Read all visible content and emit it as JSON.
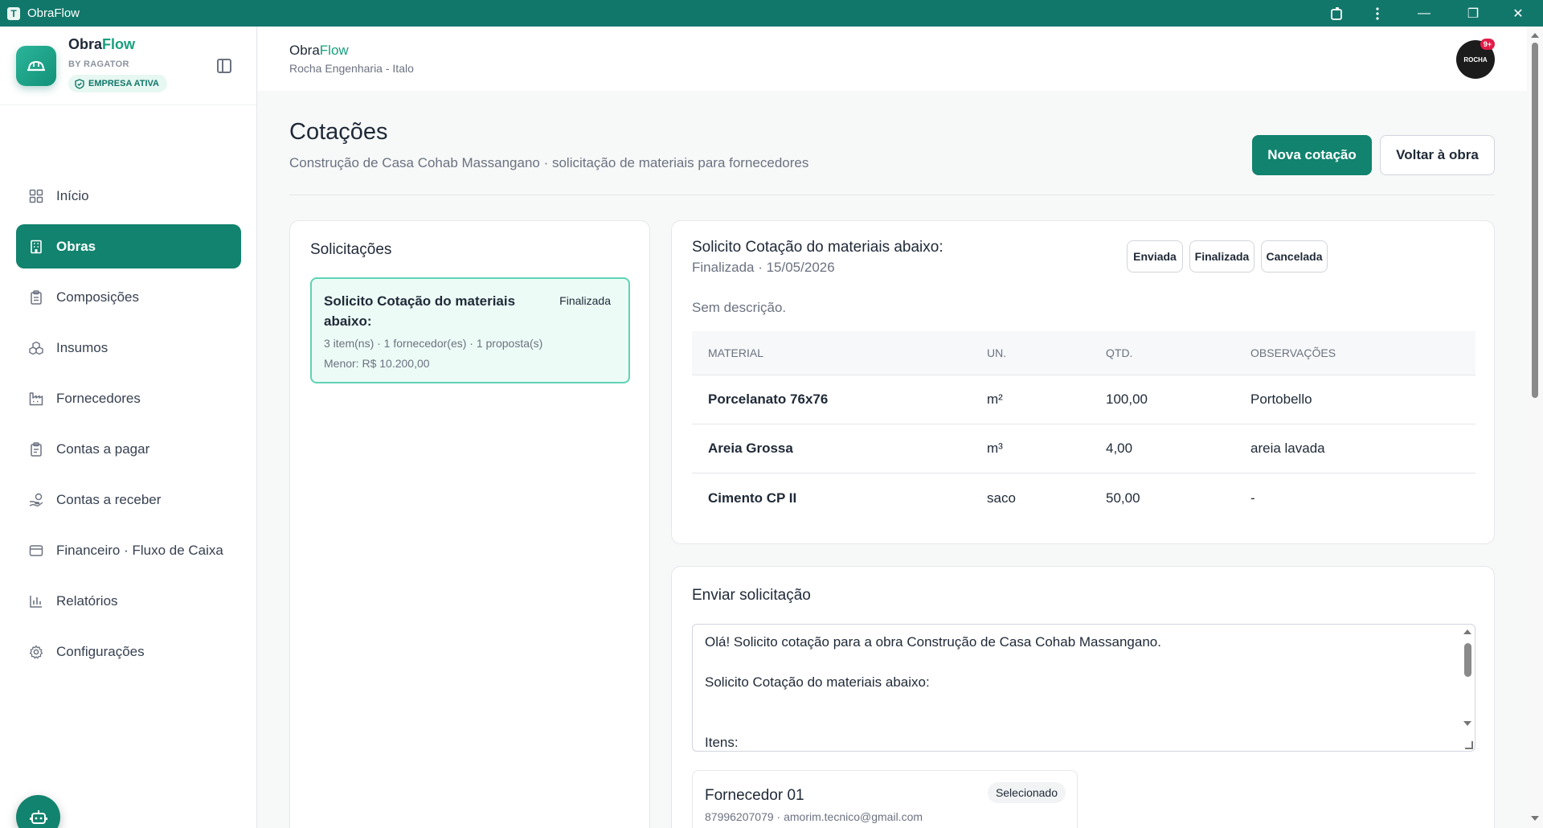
{
  "window": {
    "title": "ObraFlow",
    "controls": {
      "minimize": "—",
      "maximize": "❐",
      "close": "✕"
    }
  },
  "sidebar": {
    "brand_main": "Obra",
    "brand_accent": "Flow",
    "brand_sub": "BY RAGATOR",
    "badge": "EMPRESA ATIVA",
    "items": [
      {
        "label": "Início",
        "icon": "dashboard-icon"
      },
      {
        "label": "Obras",
        "icon": "building-icon",
        "active": true
      },
      {
        "label": "Composições",
        "icon": "clipboard-icon"
      },
      {
        "label": "Insumos",
        "icon": "boxes-icon"
      },
      {
        "label": "Fornecedores",
        "icon": "factory-icon"
      },
      {
        "label": "Contas a pagar",
        "icon": "receipt-icon"
      },
      {
        "label": "Contas a receber",
        "icon": "hand-coins-icon"
      },
      {
        "label": "Financeiro · Fluxo de Caixa",
        "icon": "wallet-icon"
      },
      {
        "label": "Relatórios",
        "icon": "bar-chart-icon"
      },
      {
        "label": "Configurações",
        "icon": "gear-icon"
      }
    ]
  },
  "header": {
    "brand_main": "Obra",
    "brand_accent": "Flow",
    "company": "Rocha Engenharia - Italo",
    "avatar_text": "ROCHA",
    "notification_count": "9+"
  },
  "page": {
    "title": "Cotações",
    "subtitle": "Construção de Casa Cohab Massangano · solicitação de materiais para fornecedores",
    "new_button": "Nova cotação",
    "back_button": "Voltar à obra"
  },
  "requests": {
    "title": "Solicitações",
    "items": [
      {
        "title": "Solicito Cotação do materiais abaixo:",
        "status": "Finalizada",
        "meta": "3 item(ns) · 1 fornecedor(es) · 1 proposta(s)",
        "min": "Menor: R$ 10.200,00"
      }
    ]
  },
  "detail": {
    "title": "Solicito Cotação do materiais abaixo:",
    "meta": "Finalizada · 15/05/2026",
    "status_buttons": [
      "Enviada",
      "Finalizada",
      "Cancelada"
    ],
    "description": "Sem descrição.",
    "columns": [
      "MATERIAL",
      "UN.",
      "QTD.",
      "OBSERVAÇÕES"
    ],
    "rows": [
      [
        "Porcelanato 76x76",
        "m²",
        "100,00",
        "Portobello"
      ],
      [
        "Areia Grossa",
        "m³",
        "4,00",
        "areia lavada"
      ],
      [
        "Cimento CP II",
        "saco",
        "50,00",
        "-"
      ]
    ]
  },
  "send": {
    "title": "Enviar solicitação",
    "message_lines": [
      "Olá! Solicito cotação para a obra Construção de Casa Cohab Massangano.",
      "",
      "Solicito Cotação do materiais abaixo:",
      "",
      "",
      "Itens:"
    ],
    "supplier": {
      "name": "Fornecedor 01",
      "contact": "87996207079 · amorim.tecnico@gmail.com",
      "badge": "Selecionado"
    }
  },
  "colors": {
    "titlebar": "#11776a",
    "primary": "#11836e",
    "accent": "#17a07f",
    "selected_bg": "#ecfbf6",
    "selected_border": "#5fd3b4"
  }
}
